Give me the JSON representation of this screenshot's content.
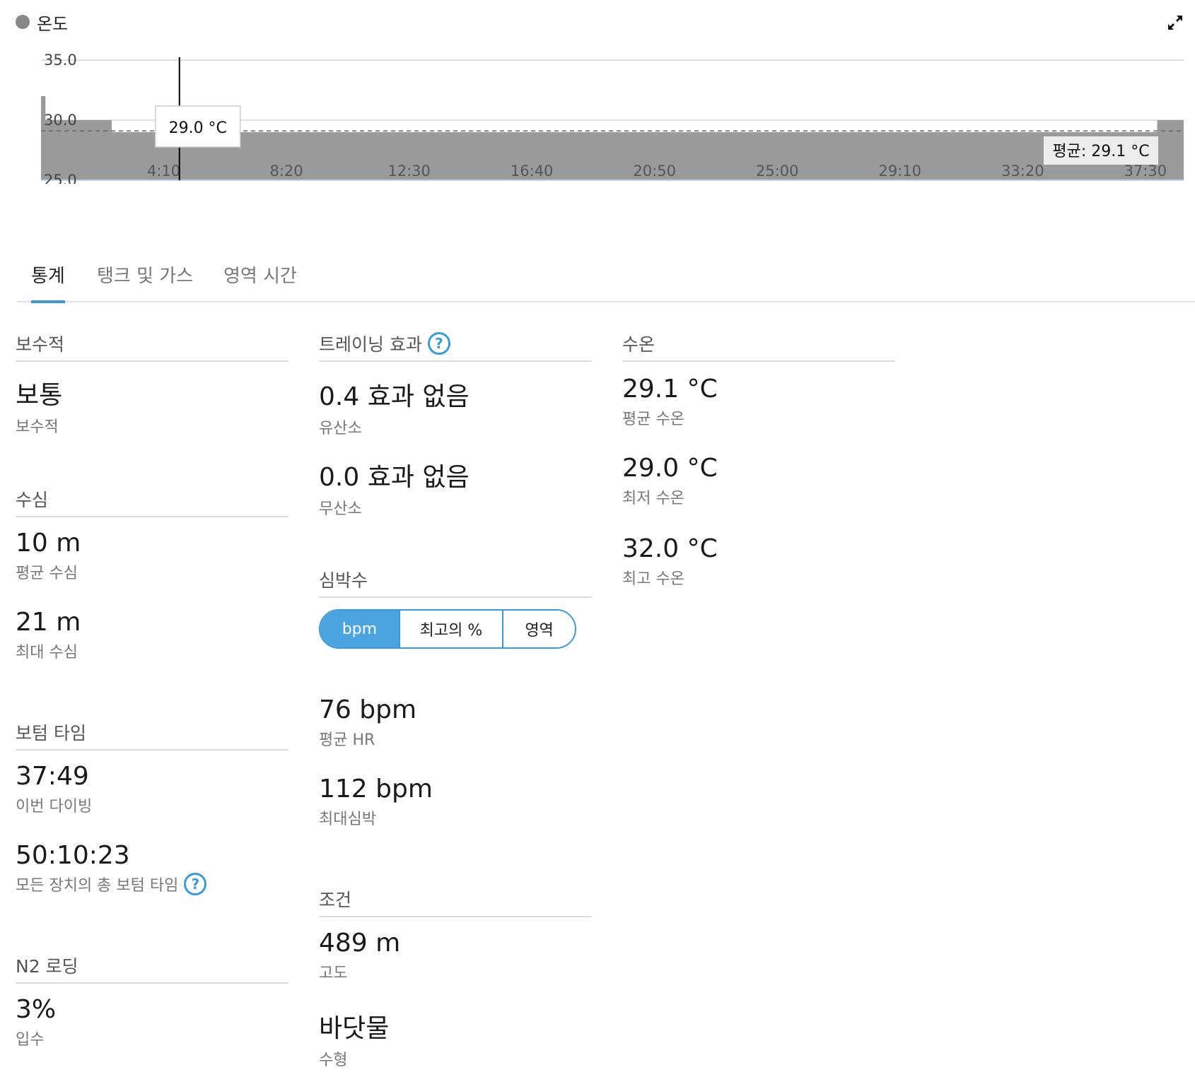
{
  "chart": {
    "title": "온도",
    "tooltip": "29.0 °C",
    "avg_label": "평균: 29.1 °C"
  },
  "chart_data": {
    "type": "area",
    "title": "온도",
    "xlabel": "",
    "ylabel": "",
    "ylim": [
      25.0,
      35.0
    ],
    "y_ticks": [
      "35.0",
      "30.0",
      "25.0"
    ],
    "x_ticks": [
      "4:10",
      "8:20",
      "12:30",
      "16:40",
      "20:50",
      "25:00",
      "29:10",
      "33:20",
      "37:30"
    ],
    "x_tick_minutes": [
      4.1667,
      8.3333,
      12.5,
      16.6667,
      20.8333,
      25.0,
      29.1667,
      33.3333,
      37.5
    ],
    "x_range_minutes": [
      0,
      38.8
    ],
    "points": [
      {
        "t": 0.0,
        "v": 32.0
      },
      {
        "t": 0.15,
        "v": 32.0
      },
      {
        "t": 0.15,
        "v": 30.0
      },
      {
        "t": 2.4,
        "v": 30.0
      },
      {
        "t": 2.4,
        "v": 29.0
      },
      {
        "t": 37.9,
        "v": 29.0
      },
      {
        "t": 37.9,
        "v": 30.0
      },
      {
        "t": 38.8,
        "v": 30.0
      }
    ],
    "average": 29.1,
    "cursor_minutes": 4.7,
    "grid": true,
    "colors": {
      "fill": "#9a9a9a",
      "cursor": "#000000",
      "grid": "#e0e0e0",
      "average_line": "#666666"
    }
  },
  "tabs": [
    "통계",
    "탱크 및 가스",
    "영역 시간"
  ],
  "sections": {
    "conservatism": {
      "title": "보수적",
      "items": [
        {
          "value": "보통",
          "label": "보수적"
        }
      ]
    },
    "depth": {
      "title": "수심",
      "items": [
        {
          "value": "10 m",
          "label": "평균 수심"
        },
        {
          "value": "21 m",
          "label": "최대 수심"
        }
      ]
    },
    "bottom_time": {
      "title": "보텀 타임",
      "items": [
        {
          "value": "37:49",
          "label": "이번 다이빙"
        },
        {
          "value": "50:10:23",
          "label": "모든 장치의 총 보텀 타임"
        }
      ]
    },
    "n2": {
      "title": "N2 로딩",
      "items": [
        {
          "value": "3%",
          "label": "입수"
        }
      ]
    },
    "training": {
      "title": "트레이닝 효과",
      "items": [
        {
          "value": "0.4 효과 없음",
          "label": "유산소"
        },
        {
          "value": "0.0 효과 없음",
          "label": "무산소"
        }
      ]
    },
    "heart_rate": {
      "title": "심박수",
      "toggle": [
        "bpm",
        "최고의 %",
        "영역"
      ],
      "items": [
        {
          "value": "76 bpm",
          "label": "평균 HR"
        },
        {
          "value": "112 bpm",
          "label": "최대심박"
        }
      ]
    },
    "conditions": {
      "title": "조건",
      "items": [
        {
          "value": "489 m",
          "label": "고도"
        },
        {
          "value": "바닷물",
          "label": "수형"
        }
      ]
    },
    "water_temp": {
      "title": "수온",
      "items": [
        {
          "value": "29.1 °C",
          "label": "평균 수온"
        },
        {
          "value": "29.0 °C",
          "label": "최저 수온"
        },
        {
          "value": "32.0 °C",
          "label": "최고 수온"
        }
      ]
    }
  },
  "help_icon": "question-circle-icon",
  "expand_icon": "expand-arrows-icon"
}
